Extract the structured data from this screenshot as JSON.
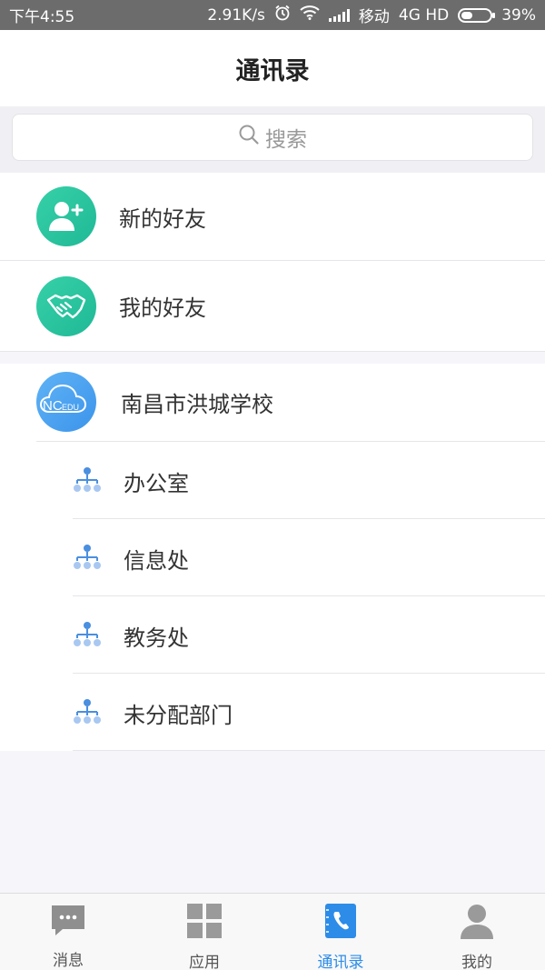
{
  "status_bar": {
    "time": "下午4:55",
    "speed": "2.91K/s",
    "carrier": "移动",
    "network": "4G HD",
    "battery": "39%",
    "battery_level": 0.39
  },
  "header": {
    "title": "通讯录"
  },
  "search": {
    "placeholder": "搜索"
  },
  "friends": [
    {
      "label": "新的好友",
      "icon": "add-user-icon"
    },
    {
      "label": "我的好友",
      "icon": "handshake-icon"
    }
  ],
  "school": {
    "name": "南昌市洪城学校",
    "logo_text": "NC",
    "logo_sub": "EDU",
    "departments": [
      {
        "label": "办公室"
      },
      {
        "label": "信息处"
      },
      {
        "label": "教务处"
      },
      {
        "label": "未分配部门"
      }
    ]
  },
  "tabs": [
    {
      "label": "消息",
      "icon": "chat-icon",
      "active": false
    },
    {
      "label": "应用",
      "icon": "grid-icon",
      "active": false
    },
    {
      "label": "通讯录",
      "icon": "contacts-icon",
      "active": true
    },
    {
      "label": "我的",
      "icon": "profile-icon",
      "active": false
    }
  ],
  "colors": {
    "accent": "#2d8ce8",
    "green": "#22bf9b",
    "blue": "#4aa3f0"
  }
}
